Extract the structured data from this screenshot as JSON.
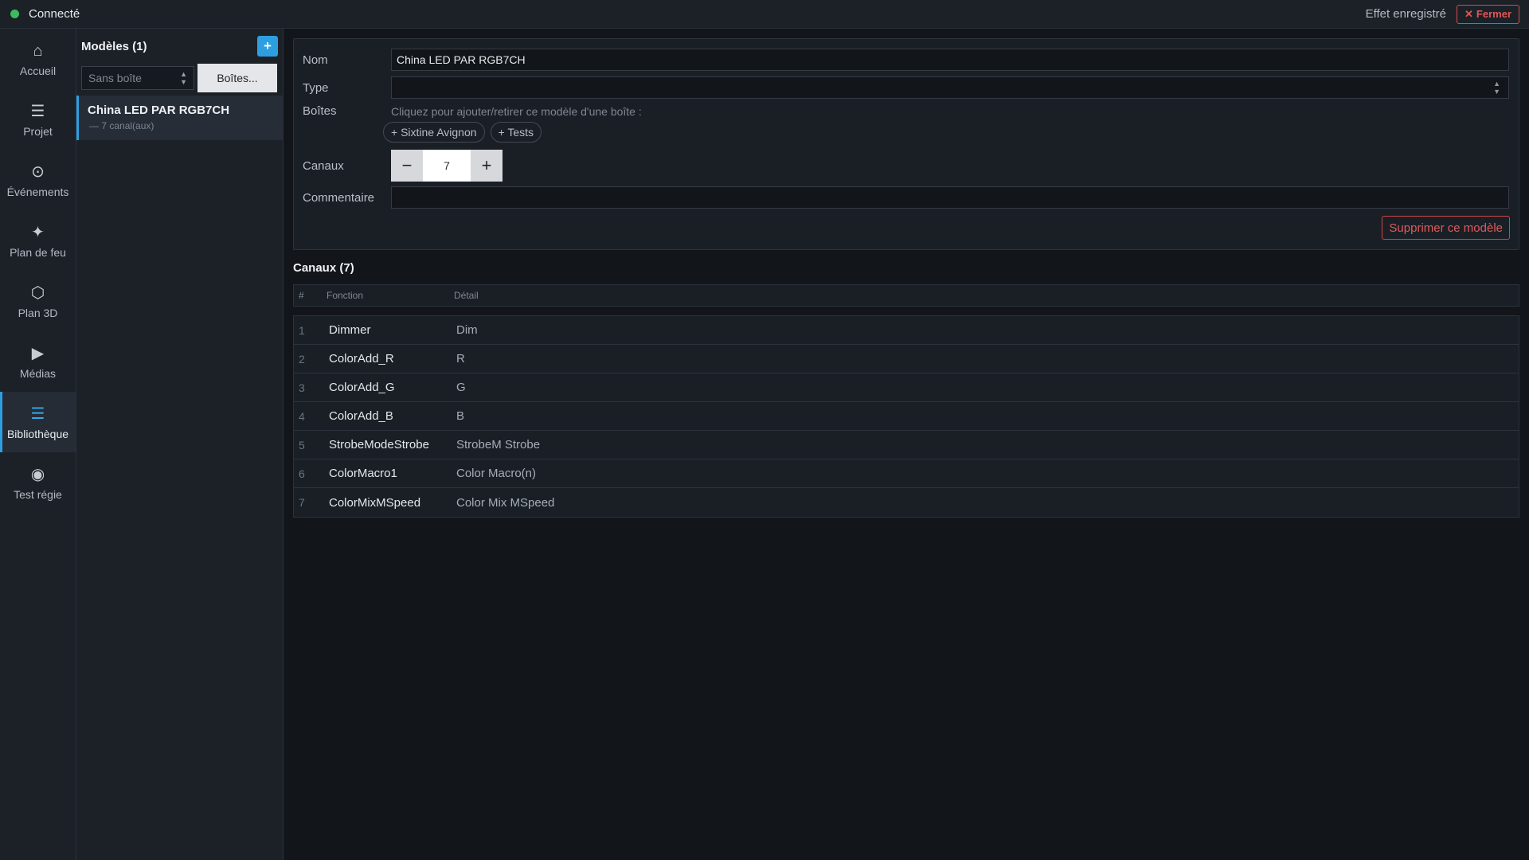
{
  "topbar": {
    "status_label": "Connecté",
    "status_color": "#3dbb5e",
    "saved_label": "Effet enregistré",
    "close_label": "Fermer"
  },
  "nav": [
    {
      "label": "Accueil",
      "icon": "home-icon",
      "glyph": "⌂"
    },
    {
      "label": "Projet",
      "icon": "menu-icon",
      "glyph": "☰"
    },
    {
      "label": "Événements",
      "icon": "target-icon",
      "glyph": "⊙"
    },
    {
      "label": "Plan de feu",
      "icon": "sparkle-icon",
      "glyph": "✦"
    },
    {
      "label": "Plan 3D",
      "icon": "hexagon-icon",
      "glyph": "⬡"
    },
    {
      "label": "Médias",
      "icon": "play-icon",
      "glyph": "▶"
    },
    {
      "label": "Bibliothèque",
      "icon": "list-icon",
      "glyph": "☰",
      "active": true
    },
    {
      "label": "Test régie",
      "icon": "record-icon",
      "glyph": "◉"
    }
  ],
  "models": {
    "title": "Modèles (1)",
    "add_label": "+",
    "box_filter": "Sans boîte",
    "boxes_button": "Boîtes...",
    "items": [
      {
        "name": "China LED PAR RGB7CH",
        "sub": "— 7 canal(aux)"
      }
    ]
  },
  "form": {
    "name_label": "Nom",
    "name_value": "China LED PAR RGB7CH",
    "type_label": "Type",
    "type_value": "",
    "boxes_label": "Boîtes",
    "boxes_hint": "Cliquez pour ajouter/retirer ce modèle d'une boîte :",
    "box_chips": [
      "+ Sixtine Avignon",
      "+ Tests"
    ],
    "channels_label": "Canaux",
    "channels_value": "7",
    "minus": "−",
    "plus": "+",
    "comment_label": "Commentaire",
    "comment_value": "",
    "delete_label": "Supprimer ce modèle"
  },
  "channels": {
    "title": "Canaux (7)",
    "headers": {
      "num": "#",
      "fn": "Fonction",
      "detail": "Détail"
    },
    "rows": [
      {
        "num": "1",
        "fn": "Dimmer",
        "detail": "Dim"
      },
      {
        "num": "2",
        "fn": "ColorAdd_R",
        "detail": "R"
      },
      {
        "num": "3",
        "fn": "ColorAdd_G",
        "detail": "G"
      },
      {
        "num": "4",
        "fn": "ColorAdd_B",
        "detail": "B"
      },
      {
        "num": "5",
        "fn": "StrobeModeStrobe",
        "detail": "StrobeM Strobe"
      },
      {
        "num": "6",
        "fn": "ColorMacro1",
        "detail": "Color Macro(n)"
      },
      {
        "num": "7",
        "fn": "ColorMixMSpeed",
        "detail": "Color Mix MSpeed"
      }
    ]
  }
}
